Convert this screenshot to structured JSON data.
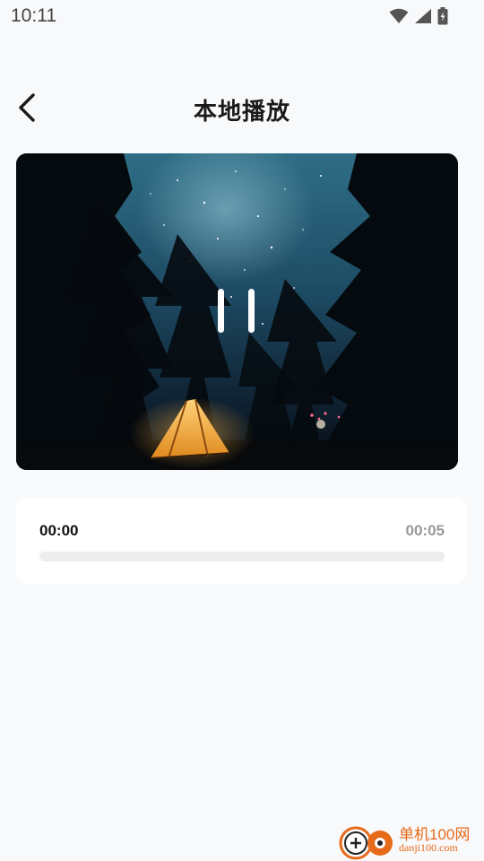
{
  "status_bar": {
    "time": "10:11",
    "icons": [
      "wifi-icon",
      "cell-signal-icon",
      "battery-charging-icon"
    ]
  },
  "header": {
    "title": "本地播放",
    "back_icon": "chevron-left-icon"
  },
  "player": {
    "state_icon": "pause-icon",
    "current_time": "00:00",
    "total_time": "00:05",
    "progress": 0
  },
  "watermark": {
    "brand": "单机100网",
    "domain": "danji100.com"
  },
  "colors": {
    "background": "#f8f9fb",
    "card": "#ffffff",
    "track": "#ededed",
    "watermark": "#e76a18"
  }
}
